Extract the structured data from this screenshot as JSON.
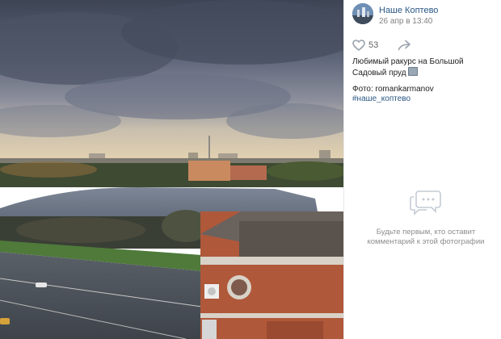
{
  "post": {
    "author": "Наше Коптево",
    "date": "26 апр в 13:40",
    "likes": "53",
    "caption": "Любимый ракурс на Большой Садовый пруд",
    "photo_credit": "Фото: romankarmanov",
    "hashtag": "#наше_коптево"
  },
  "comments": {
    "empty_text": "Будьте первым, кто оставит комментарий к этой фотографии"
  },
  "icons": {
    "like": "heart-outline-icon",
    "share": "share-arrow-icon",
    "empty_comments": "speech-bubbles-icon"
  },
  "colors": {
    "link": "#2a5885",
    "muted": "#828282",
    "icon": "#99a2ad"
  }
}
